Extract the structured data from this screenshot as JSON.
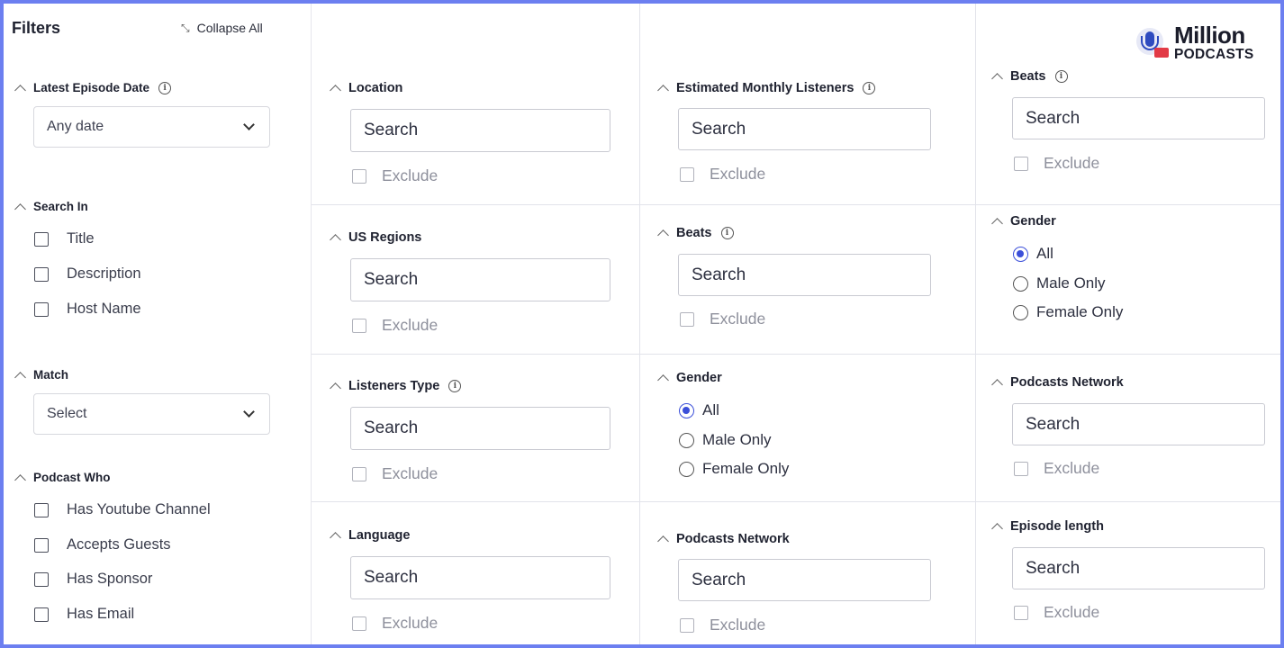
{
  "sidebar": {
    "title": "Filters",
    "collapse_label": "Collapse All",
    "latest_episode": {
      "label": "Latest Episode Date",
      "value": "Any date"
    },
    "search_in": {
      "label": "Search In",
      "options": [
        "Title",
        "Description",
        "Host Name"
      ]
    },
    "match": {
      "label": "Match",
      "value": "Select"
    },
    "podcast_who": {
      "label": "Podcast Who",
      "options": [
        "Has Youtube Channel",
        "Accepts Guests",
        "Has Sponsor",
        "Has Email"
      ]
    }
  },
  "logo": {
    "line1": "Million",
    "line2": "PODCASTS"
  },
  "common": {
    "search_placeholder": "Search",
    "exclude_label": "Exclude"
  },
  "col1": {
    "location": "Location",
    "us_regions": "US Regions",
    "listeners_type": "Listeners Type",
    "language": "Language"
  },
  "col2": {
    "estimated_listeners": "Estimated Monthly Listeners",
    "beats": "Beats",
    "gender": {
      "label": "Gender",
      "options": [
        "All",
        "Male Only",
        "Female Only"
      ]
    },
    "podcasts_network": "Podcasts Network"
  },
  "col3": {
    "beats": "Beats",
    "gender": {
      "label": "Gender",
      "options": [
        "All",
        "Male Only",
        "Female Only"
      ]
    },
    "podcasts_network": "Podcasts Network",
    "episode_length": "Episode length"
  }
}
